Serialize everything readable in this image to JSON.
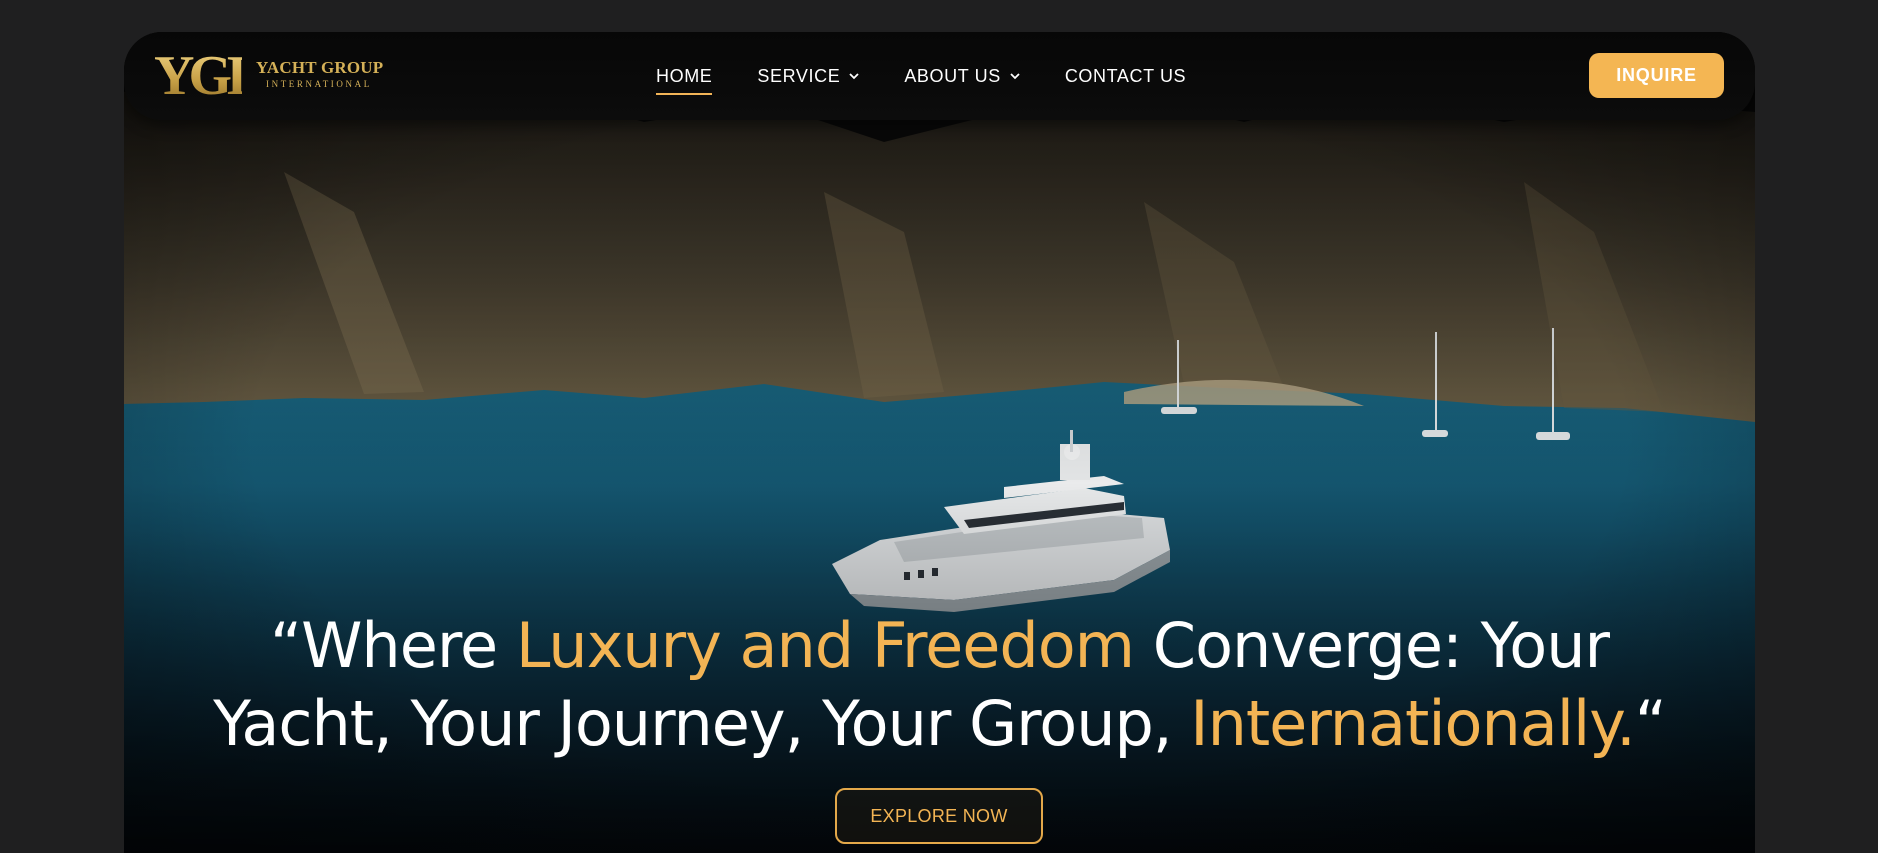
{
  "brand": {
    "mark": "YGI",
    "name_line1": "YACHT GROUP",
    "name_line2": "INTERNATIONAL",
    "gold": "#f3b454"
  },
  "nav": {
    "items": [
      {
        "label": "HOME",
        "active": true
      },
      {
        "label": "SERVICE",
        "dropdown": true,
        "icon": "chevron-down-icon"
      },
      {
        "label": "ABOUT US",
        "dropdown": true,
        "icon": "chevron-down-icon"
      },
      {
        "label": "CONTACT US"
      }
    ]
  },
  "cta": {
    "inquire_label": "INQUIRE"
  },
  "hero": {
    "quote_open": "“",
    "part1": "Where ",
    "highlight1": "Luxury and Freedom",
    "part2": " Converge: Your",
    "part3": "Yacht, Your Journey, Your Group, ",
    "highlight2": "Internationally.",
    "quote_close": "“",
    "button_label": "EXPLORE NOW"
  }
}
